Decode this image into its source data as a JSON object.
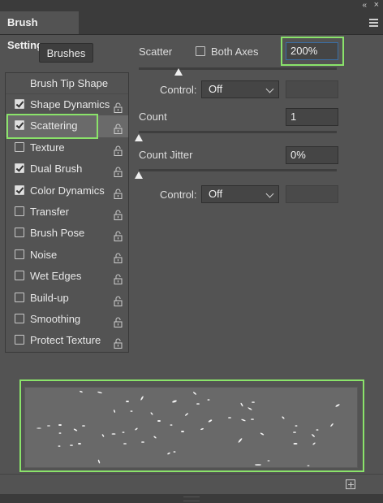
{
  "window": {
    "title": "Brush Settings",
    "collapse_icon": "double-chevron-left",
    "close_icon": "close",
    "menu_icon": "hamburger"
  },
  "brushes_button": {
    "label": "Brushes"
  },
  "settings_list": {
    "tip_shape_label": "Brush Tip Shape",
    "items": [
      {
        "label": "Shape Dynamics",
        "checked": true,
        "selected": false
      },
      {
        "label": "Scattering",
        "checked": true,
        "selected": true
      },
      {
        "label": "Texture",
        "checked": false,
        "selected": false
      },
      {
        "label": "Dual Brush",
        "checked": true,
        "selected": false
      },
      {
        "label": "Color Dynamics",
        "checked": true,
        "selected": false
      },
      {
        "label": "Transfer",
        "checked": false,
        "selected": false
      },
      {
        "label": "Brush Pose",
        "checked": false,
        "selected": false
      },
      {
        "label": "Noise",
        "checked": false,
        "selected": false
      },
      {
        "label": "Wet Edges",
        "checked": false,
        "selected": false
      },
      {
        "label": "Build-up",
        "checked": false,
        "selected": false
      },
      {
        "label": "Smoothing",
        "checked": false,
        "selected": false
      },
      {
        "label": "Protect Texture",
        "checked": false,
        "selected": false
      }
    ]
  },
  "scattering": {
    "scatter_label": "Scatter",
    "both_axes_label": "Both Axes",
    "both_axes_checked": false,
    "scatter_value": "200%",
    "scatter_control_label": "Control:",
    "scatter_control_value": "Off",
    "count_label": "Count",
    "count_value": "1",
    "count_jitter_label": "Count Jitter",
    "count_jitter_value": "0%",
    "jitter_control_label": "Control:",
    "jitter_control_value": "Off"
  },
  "highlight_color": "#8ae36a",
  "footer": {
    "new_brush_icon": "create-new-brush"
  }
}
